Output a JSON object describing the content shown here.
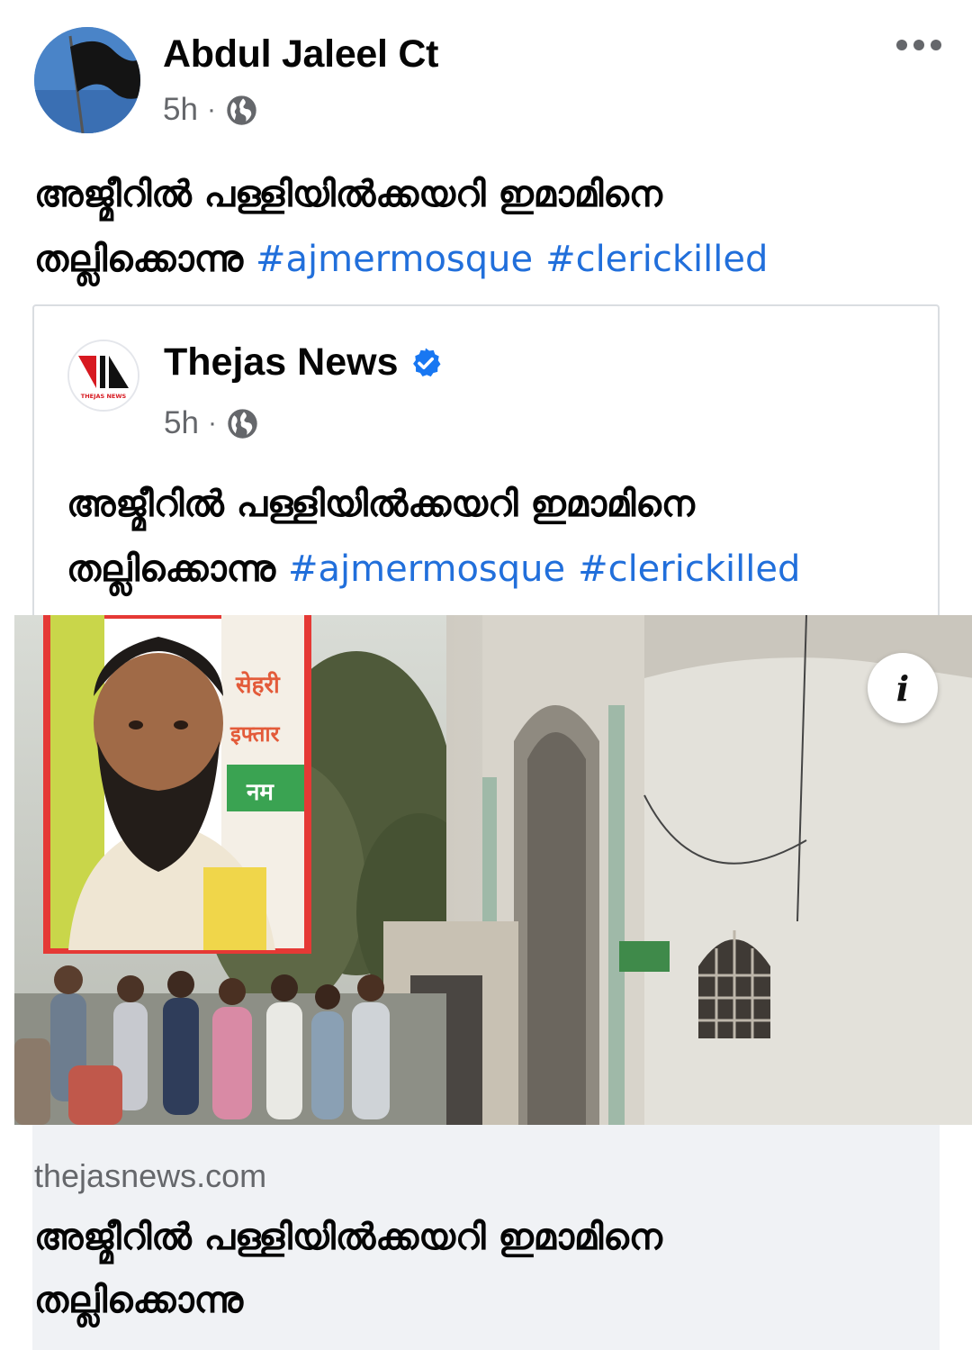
{
  "post": {
    "author": "Abdul Jaleel Ct",
    "time": "5h",
    "separator": "·",
    "text_line1": "അജ്മീറിൽ പള്ളിയിൽക്കയറി ഇമാമിനെ",
    "text_line2": "തല്ലിക്കൊന്നു",
    "hashtag1": "#ajmermosque",
    "hashtag2": "#clerickilled",
    "menu_icon": "more-horizontal-icon",
    "audience_icon": "globe-icon"
  },
  "shared": {
    "page_name": "Thejas News",
    "logo_text": "THEJAS NEWS",
    "verified_icon": "verified-badge-icon",
    "time": "5h",
    "separator": "·",
    "text_line1": "അജ്മീറിൽ പള്ളിയിൽക്കയറി ഇമാമിനെ",
    "text_line2": "തല്ലിക്കൊന്നു",
    "hashtag1": "#ajmermosque",
    "hashtag2": "#clerickilled"
  },
  "link": {
    "info_label": "i",
    "domain": "thejasnews.com",
    "title_line1": "അജ്മീറിൽ പള്ളിയിൽക്കയറി ഇമാമിനെ",
    "title_line2": "തല്ലിക്കൊന്നു",
    "image_sign_lines": [
      "सेहरी",
      "इफ्तार",
      "नम"
    ]
  },
  "colors": {
    "hashtag": "#216fdb",
    "verified": "#1877f2",
    "secondary_text": "#65676b",
    "link_footer_bg": "#f0f2f5",
    "inset_border": "#e53935"
  }
}
